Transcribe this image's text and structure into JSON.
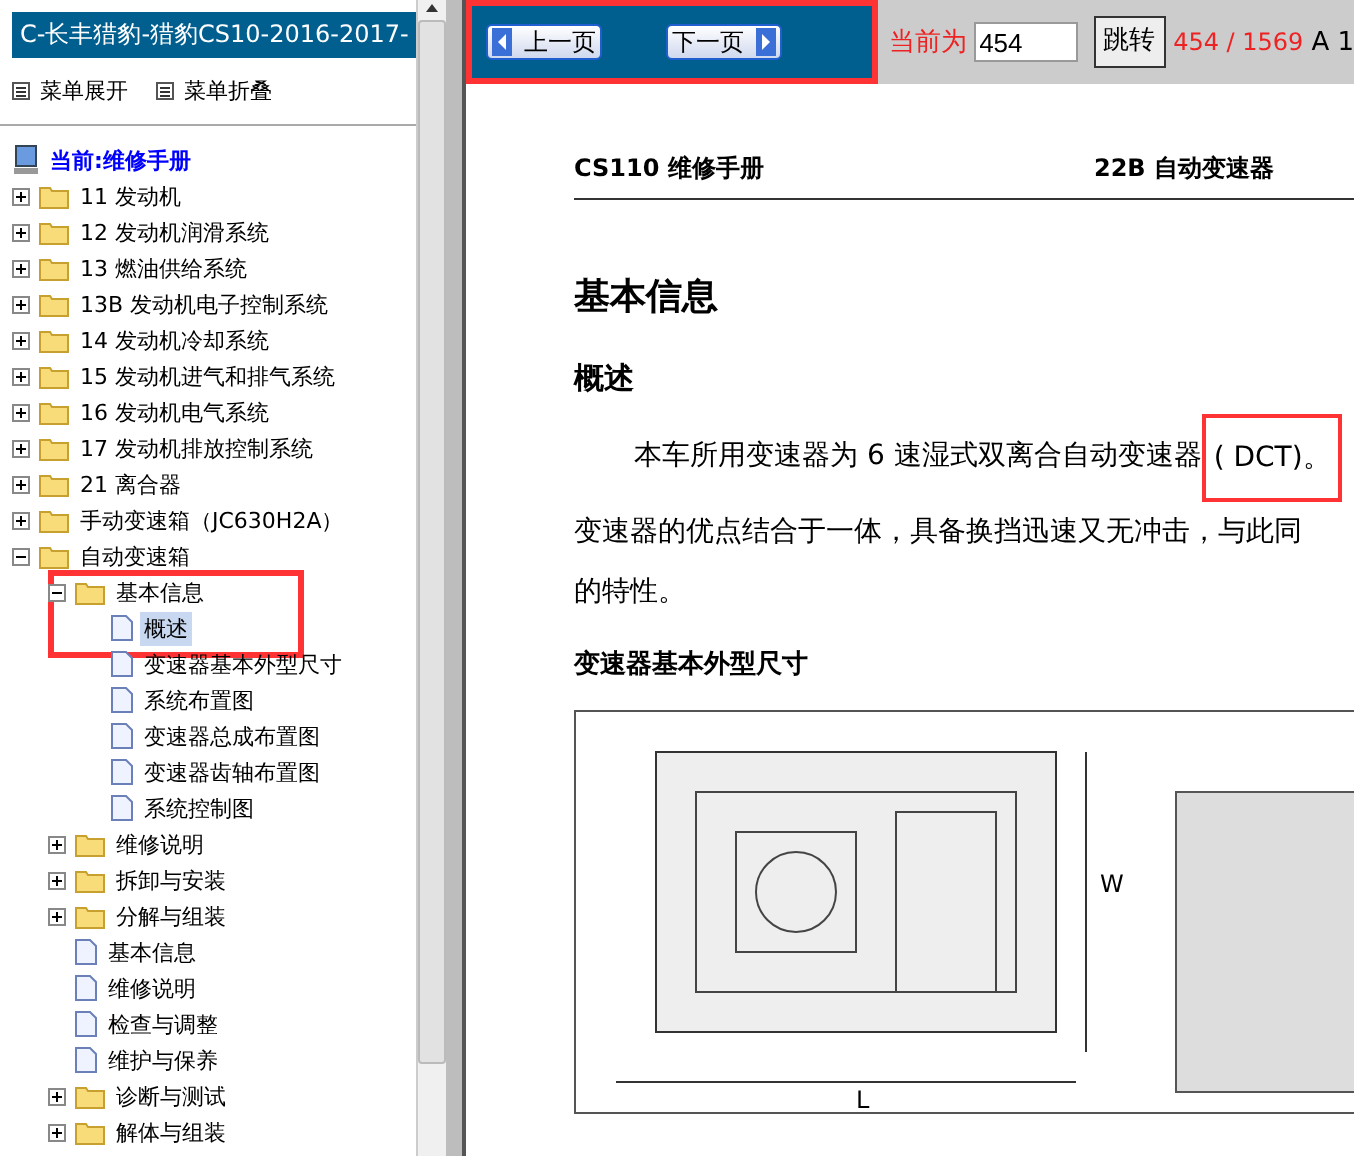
{
  "sidebar": {
    "title": "C-长丰猎豹-猎豹CS10-2016-2017-",
    "menu_buttons": [
      "菜单展开",
      "菜单折叠"
    ],
    "root": "当前:维修手册",
    "tree": [
      {
        "label": "11 发动机",
        "kind": "folder",
        "expanded": false,
        "selected": false
      },
      {
        "label": "12 发动机润滑系统",
        "kind": "folder",
        "expanded": false,
        "selected": false
      },
      {
        "label": "13 燃油供给系统",
        "kind": "folder",
        "expanded": false,
        "selected": false
      },
      {
        "label": "13B 发动机电子控制系统",
        "kind": "folder",
        "expanded": false,
        "selected": false
      },
      {
        "label": "14 发动机冷却系统",
        "kind": "folder",
        "expanded": false,
        "selected": false
      },
      {
        "label": "15 发动机进气和排气系统",
        "kind": "folder",
        "expanded": false,
        "selected": false
      },
      {
        "label": "16 发动机电气系统",
        "kind": "folder",
        "expanded": false,
        "selected": false
      },
      {
        "label": "17 发动机排放控制系统",
        "kind": "folder",
        "expanded": false,
        "selected": false
      },
      {
        "label": "21 离合器",
        "kind": "folder",
        "expanded": false,
        "selected": false
      },
      {
        "label": "手动变速箱（JC630H2A）",
        "kind": "folder",
        "expanded": false,
        "selected": false
      },
      {
        "label": "自动变速箱",
        "kind": "folder",
        "expanded": true,
        "selected": false,
        "children": [
          {
            "label": "基本信息",
            "kind": "folder",
            "expanded": true,
            "selected": false,
            "children": [
              {
                "label": "概述",
                "kind": "page",
                "selected": true
              },
              {
                "label": "变速器基本外型尺寸",
                "kind": "page",
                "selected": false
              },
              {
                "label": "系统布置图",
                "kind": "page",
                "selected": false
              },
              {
                "label": "变速器总成布置图",
                "kind": "page",
                "selected": false
              },
              {
                "label": "变速器齿轴布置图",
                "kind": "page",
                "selected": false
              },
              {
                "label": "系统控制图",
                "kind": "page",
                "selected": false
              }
            ]
          },
          {
            "label": "维修说明",
            "kind": "folder",
            "expanded": false,
            "selected": false
          },
          {
            "label": "拆卸与安装",
            "kind": "folder",
            "expanded": false,
            "selected": false
          },
          {
            "label": "分解与组装",
            "kind": "folder",
            "expanded": false,
            "selected": false
          },
          {
            "label": "基本信息",
            "kind": "page",
            "selected": false
          },
          {
            "label": "维修说明",
            "kind": "page",
            "selected": false
          },
          {
            "label": "检查与调整",
            "kind": "page",
            "selected": false
          },
          {
            "label": "维护与保养",
            "kind": "page",
            "selected": false
          },
          {
            "label": "诊断与测试",
            "kind": "folder",
            "expanded": false,
            "selected": false
          },
          {
            "label": "解体与组装",
            "kind": "folder",
            "expanded": false,
            "selected": false
          }
        ]
      }
    ]
  },
  "toolbar": {
    "prev": "上一页",
    "next": "下一页",
    "highlighted": true,
    "current_label": "当前为",
    "page_input": "454",
    "go_button": "跳转",
    "page_count": "454 / 1569",
    "extra": "A 1"
  },
  "document": {
    "header_left": "CS110 维修手册",
    "header_right": "22B 自动变速器",
    "title": "基本信息",
    "section": "概述",
    "paragraph_lines": [
      "本车所用变速器为 6 速湿式双离合自动变速器",
      "变速器的优点结合于一体，具备换挡迅速又无冲击，与此同",
      "的特性。"
    ],
    "highlighted_text": "( DCT)。",
    "subsection": "变速器基本外型尺寸",
    "figure_labels": [
      "W",
      "L"
    ]
  }
}
